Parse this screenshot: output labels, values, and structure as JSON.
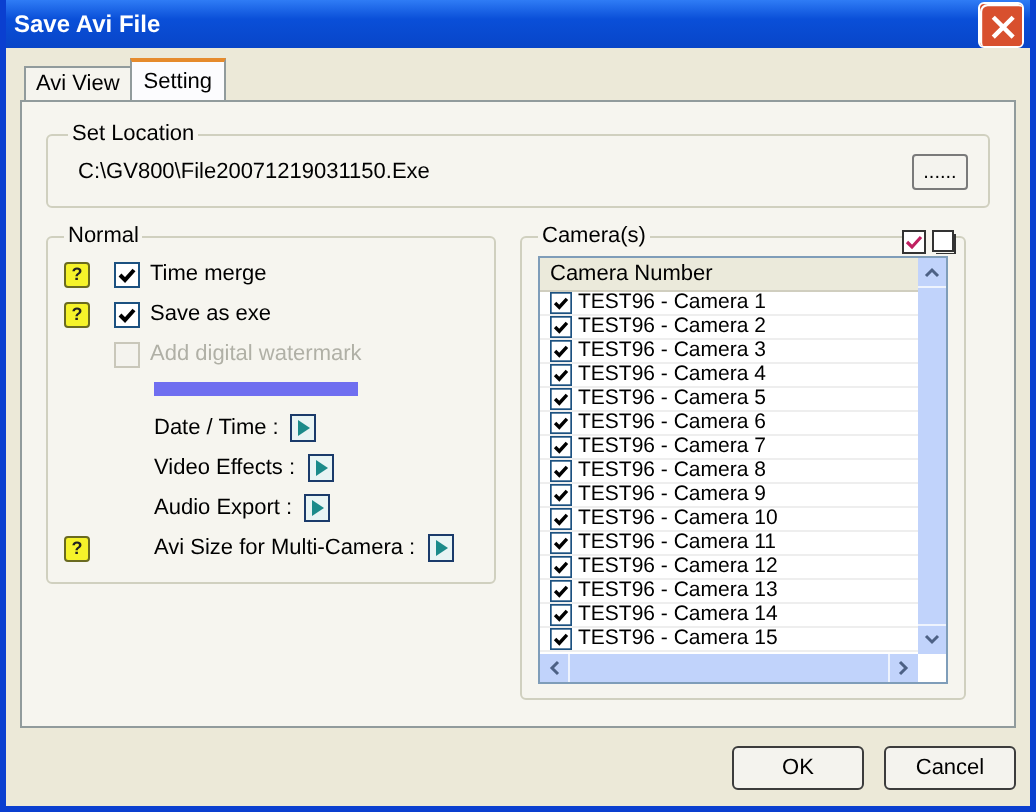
{
  "window": {
    "title": "Save Avi File"
  },
  "tabs": [
    {
      "label": "Avi View",
      "selected": false
    },
    {
      "label": "Setting",
      "selected": true
    }
  ],
  "set_location": {
    "label": "Set Location",
    "path": "C:\\GV800\\File20071219031150.Exe",
    "browse_button": "......"
  },
  "normal": {
    "label": "Normal",
    "items": [
      {
        "kind": "checkbox",
        "help": "?",
        "label": "Time merge",
        "checked": true,
        "disabled": false
      },
      {
        "kind": "checkbox",
        "help": "?",
        "label": "Save as exe",
        "checked": true,
        "disabled": false
      },
      {
        "kind": "checkbox",
        "label": "Add digital watermark",
        "checked": false,
        "disabled": true
      },
      {
        "kind": "bar"
      },
      {
        "kind": "option",
        "label": "Date / Time :"
      },
      {
        "kind": "option",
        "label": "Video Effects :"
      },
      {
        "kind": "option",
        "label": "Audio Export :"
      },
      {
        "kind": "option",
        "help": "?",
        "label": "Avi Size for Multi-Camera :"
      }
    ]
  },
  "cameras": {
    "label": "Camera(s)",
    "column": "Camera Number",
    "items": [
      {
        "label": "TEST96 - Camera 1",
        "checked": true
      },
      {
        "label": "TEST96 - Camera 2",
        "checked": true
      },
      {
        "label": "TEST96 - Camera 3",
        "checked": true
      },
      {
        "label": "TEST96 - Camera 4",
        "checked": true
      },
      {
        "label": "TEST96 - Camera 5",
        "checked": true
      },
      {
        "label": "TEST96 - Camera 6",
        "checked": true
      },
      {
        "label": "TEST96 - Camera 7",
        "checked": true
      },
      {
        "label": "TEST96 - Camera 8",
        "checked": true
      },
      {
        "label": "TEST96 - Camera 9",
        "checked": true
      },
      {
        "label": "TEST96 - Camera 10",
        "checked": true
      },
      {
        "label": "TEST96 - Camera 11",
        "checked": true
      },
      {
        "label": "TEST96 - Camera 12",
        "checked": true
      },
      {
        "label": "TEST96 - Camera 13",
        "checked": true
      },
      {
        "label": "TEST96 - Camera 14",
        "checked": true
      },
      {
        "label": "TEST96 - Camera 15",
        "checked": true
      }
    ]
  },
  "buttons": [
    "OK",
    "Cancel"
  ]
}
